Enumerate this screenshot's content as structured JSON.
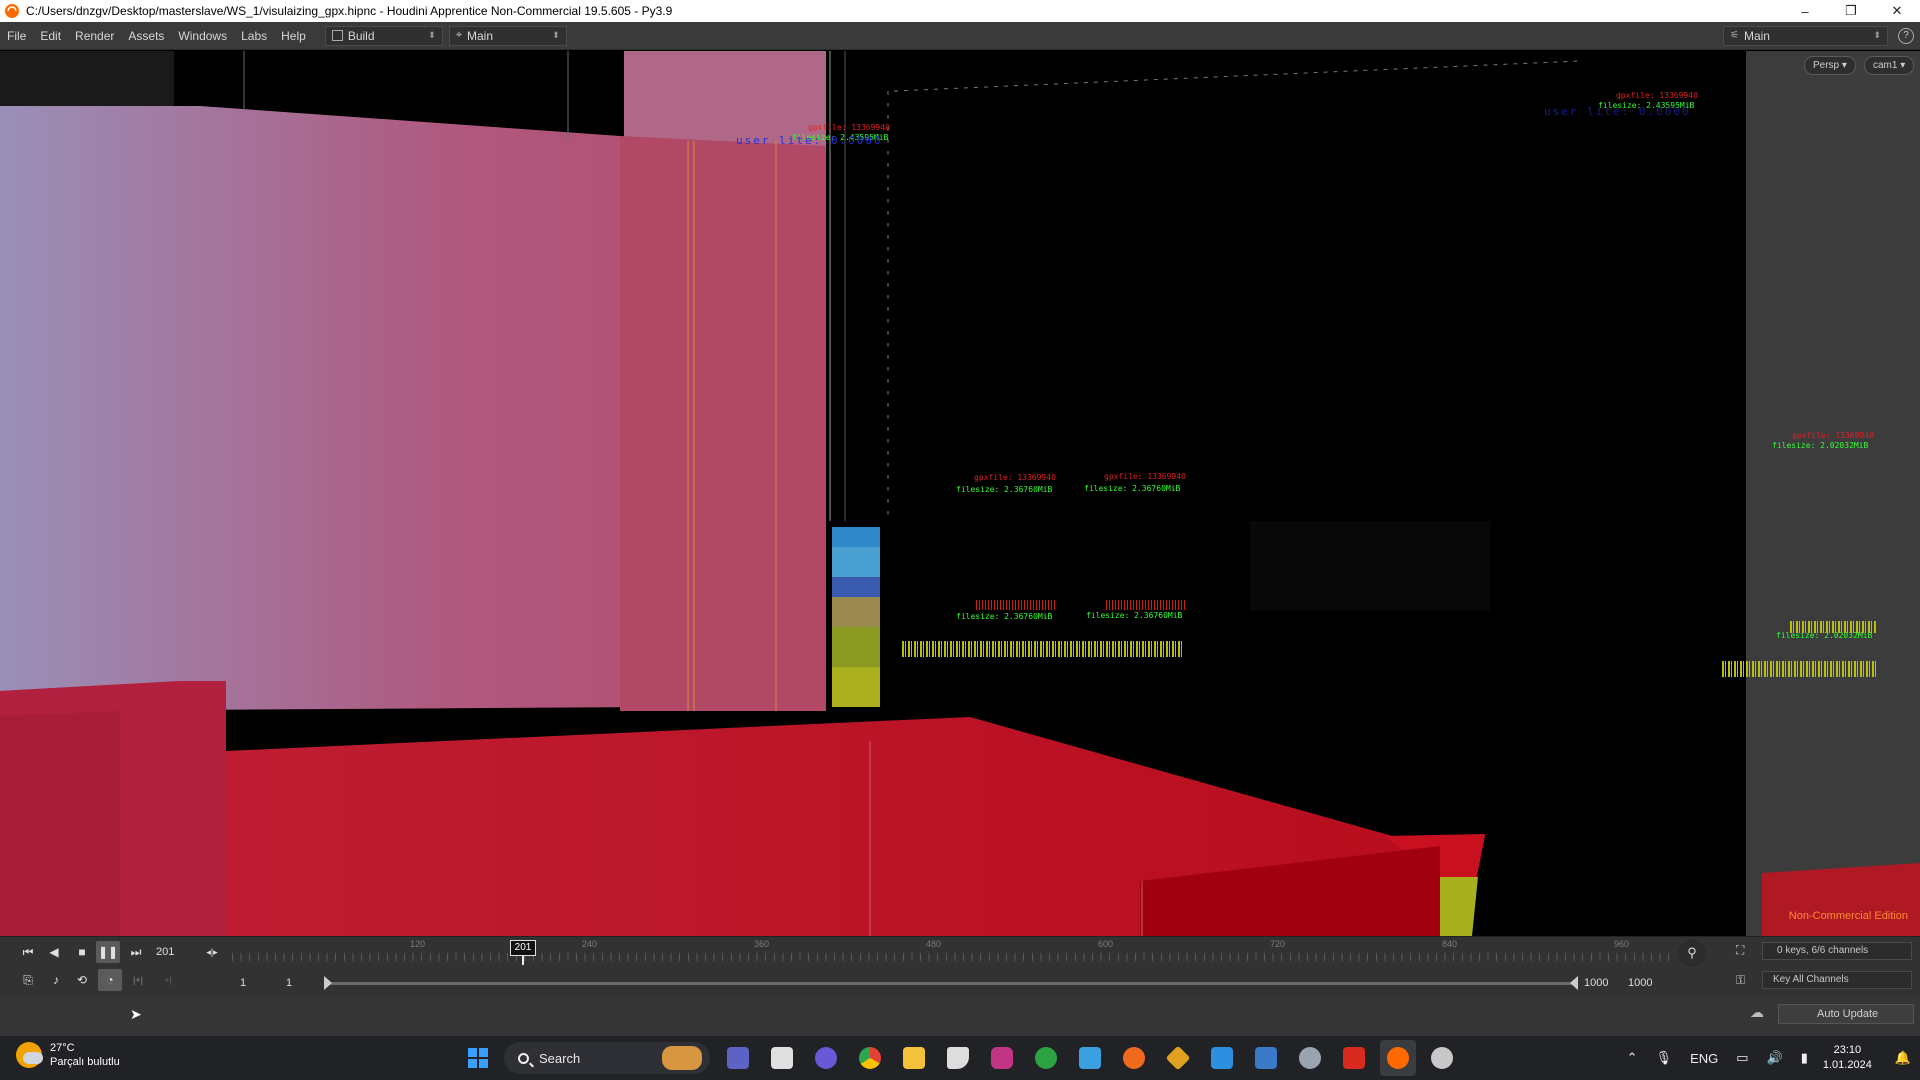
{
  "window": {
    "title": "C:/Users/dnzgv/Desktop/masterslave/WS_1/visulaizing_gpx.hipnc - Houdini Apprentice Non-Commercial 19.5.605 - Py3.9",
    "controls": [
      "–",
      "❐",
      "✕"
    ]
  },
  "menu": {
    "items": [
      "File",
      "Edit",
      "Render",
      "Assets",
      "Windows",
      "Labs",
      "Help"
    ],
    "build_desk": "Build",
    "main_desk": "Main",
    "right_desk": "Main"
  },
  "viewport": {
    "persp_button": "Persp ▾",
    "cam_button": "cam1 ▾",
    "watermark": "Non-Commercial Edition",
    "labels": [
      {
        "kind": "red",
        "text": "gpxfile: 13369940"
      },
      {
        "kind": "green",
        "text": "filesize: 2.43595MiB"
      },
      {
        "kind": "blue",
        "text": "user lite: 0.0000"
      },
      {
        "kind": "red",
        "text": "gpxfile: 13369940"
      },
      {
        "kind": "green",
        "text": "filesize: 2.43595MiB"
      },
      {
        "kind": "blue",
        "text": "user lite: 0.0000"
      },
      {
        "kind": "red",
        "text": "gpxfile: 13369940"
      },
      {
        "kind": "green",
        "text": "filesize: 2.36760MiB"
      },
      {
        "kind": "red",
        "text": "gpxfile: 13369940"
      },
      {
        "kind": "green",
        "text": "filesize: 2.36760MiB"
      },
      {
        "kind": "red",
        "text": "gpxfile: 13369940"
      },
      {
        "kind": "green",
        "text": "filesize: 2.02032MiB"
      },
      {
        "kind": "green",
        "text": "filesize: 2.36760MiB"
      },
      {
        "kind": "green",
        "text": "filesize: 2.36760MiB"
      },
      {
        "kind": "green",
        "text": "filesize: 2.02032MiB"
      }
    ]
  },
  "timeline": {
    "current_frame": "201",
    "playhead_label": "201",
    "tick_labels": [
      "120",
      "240",
      "360",
      "480",
      "600",
      "720",
      "840",
      "960"
    ],
    "range_start_a": "1",
    "range_start_b": "1",
    "range_end_a": "1000",
    "range_end_b": "1000",
    "keys_info": "0 keys, 6/6 channels",
    "key_all": "Key All Channels"
  },
  "status": {
    "auto_update": "Auto Update"
  },
  "taskbar": {
    "weather_temp": "27°C",
    "weather_desc": "Parçalı bulutlu",
    "search_placeholder": "Search",
    "apps": [
      {
        "name": "windows-start-icon",
        "color": "#3aa0ff"
      },
      {
        "name": "teams-icon",
        "color": "#5b63c7"
      },
      {
        "name": "file-manager-icon",
        "color": "#e0e0e0"
      },
      {
        "name": "chat-icon",
        "color": "#6b58d6"
      },
      {
        "name": "chrome-icon",
        "color": "#e34133"
      },
      {
        "name": "explorer-icon",
        "color": "#f3c23a"
      },
      {
        "name": "inkscape-icon",
        "color": "#dddddd"
      },
      {
        "name": "instagram-icon",
        "color": "#c13584"
      },
      {
        "name": "xbox-icon",
        "color": "#2ca243"
      },
      {
        "name": "notepad-icon",
        "color": "#3ba0e0"
      },
      {
        "name": "houdini-launcher-icon",
        "color": "#f06a1d"
      },
      {
        "name": "git-icon",
        "color": "#e0a020"
      },
      {
        "name": "vscode-icon",
        "color": "#2c8fe0"
      },
      {
        "name": "mail-icon",
        "color": "#3a78c8"
      },
      {
        "name": "settings-icon",
        "color": "#9aa4b0"
      },
      {
        "name": "pdf-icon",
        "color": "#d82a1e"
      },
      {
        "name": "houdini-icon",
        "color": "#ff6a00"
      },
      {
        "name": "steam-icon",
        "color": "#c8c8c8"
      }
    ],
    "lang": "ENG",
    "time": "23:10",
    "date": "1.01.2024"
  }
}
